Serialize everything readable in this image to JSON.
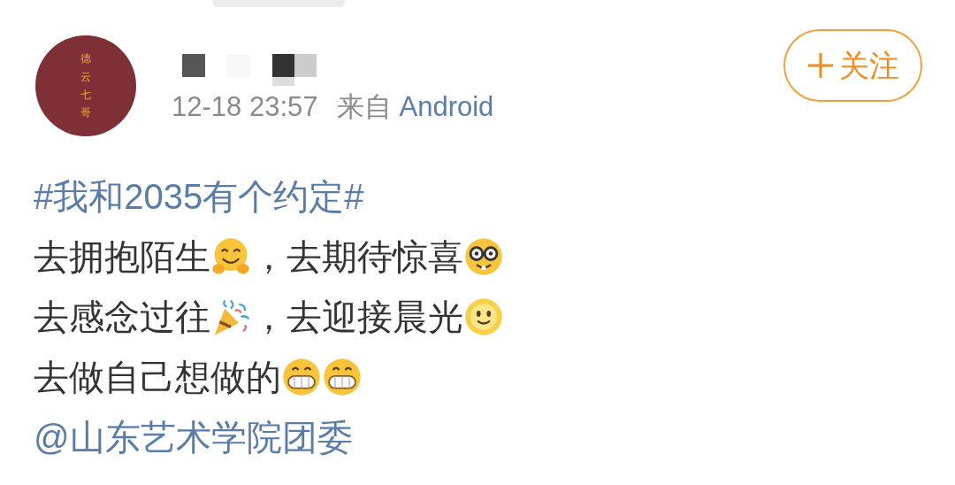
{
  "author": {
    "avatar_text": "德云七哥",
    "time": "12-18 23:57",
    "source_prefix": "来自",
    "source": "Android"
  },
  "follow_button": {
    "label": "关注"
  },
  "post": {
    "lines": [
      {
        "segments": [
          {
            "kind": "link",
            "text": "#我和2035有个约定#"
          }
        ]
      },
      {
        "segments": [
          {
            "kind": "text",
            "text": "去拥抱陌生"
          },
          {
            "kind": "hug"
          },
          {
            "kind": "text",
            "text": "，去期待惊喜"
          },
          {
            "kind": "nerd"
          }
        ]
      },
      {
        "segments": [
          {
            "kind": "text",
            "text": "去感念过往"
          },
          {
            "kind": "party"
          },
          {
            "kind": "text",
            "text": "，去迎接晨光"
          },
          {
            "kind": "sun"
          }
        ]
      },
      {
        "segments": [
          {
            "kind": "text",
            "text": "去做自己想做的"
          },
          {
            "kind": "grin"
          },
          {
            "kind": "grin"
          }
        ]
      },
      {
        "segments": [
          {
            "kind": "link",
            "text": "@山东艺术学院团委"
          }
        ]
      }
    ]
  }
}
